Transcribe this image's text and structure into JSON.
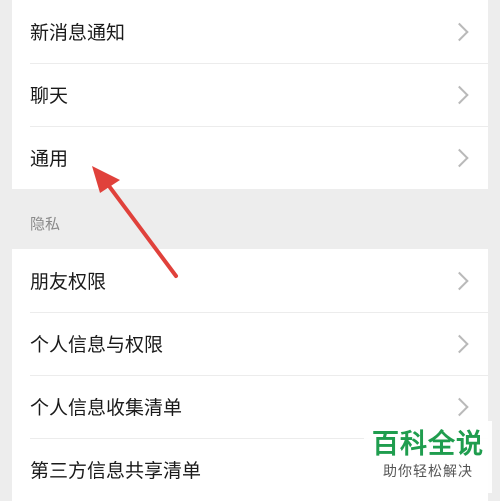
{
  "settings": {
    "group1": [
      {
        "label": "新消息通知"
      },
      {
        "label": "聊天"
      },
      {
        "label": "通用"
      }
    ],
    "privacy_header": "隐私",
    "group2": [
      {
        "label": "朋友权限"
      },
      {
        "label": "个人信息与权限"
      },
      {
        "label": "个人信息收集清单"
      },
      {
        "label": "第三方信息共享清单"
      }
    ]
  },
  "annotation": {
    "arrow_color": "#e0413b",
    "points_to": "通用"
  },
  "watermark": {
    "title": "百科全说",
    "subtitle": "助你轻松解决"
  },
  "icons": {
    "row_chevron": "chevron-right-icon"
  }
}
